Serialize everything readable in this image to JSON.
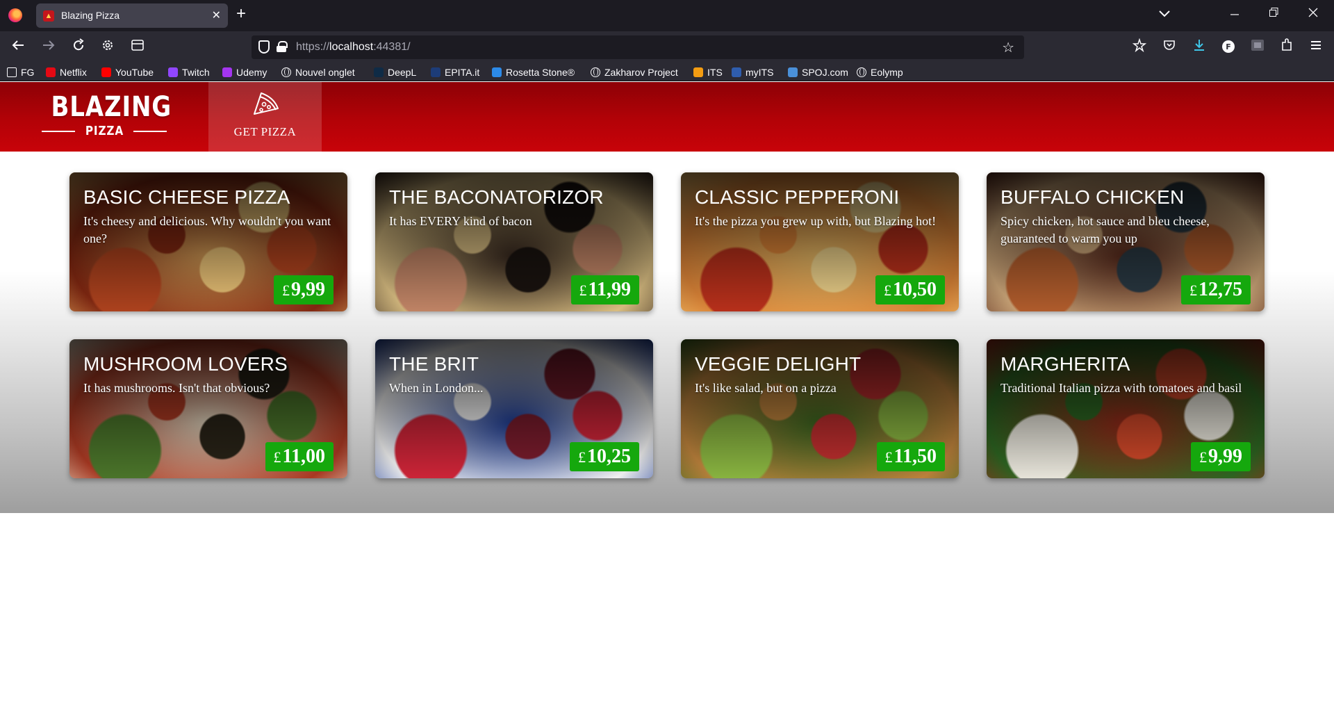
{
  "browser": {
    "tab": {
      "title": "Blazing Pizza",
      "favicon": "pizza-slice-icon"
    },
    "url": {
      "scheme": "https://",
      "host": "localhost",
      "port": ":44381/"
    },
    "bookmarks": [
      {
        "label": "FG",
        "icon": "folder-icon",
        "color": "#fbfbfe"
      },
      {
        "label": "Netflix",
        "icon": "netflix-icon",
        "color": "#e50914"
      },
      {
        "label": "YouTube",
        "icon": "youtube-icon",
        "color": "#ff0000"
      },
      {
        "label": "Twitch",
        "icon": "twitch-icon",
        "color": "#9146ff"
      },
      {
        "label": "Udemy",
        "icon": "udemy-icon",
        "color": "#a435f0"
      },
      {
        "label": "Nouvel onglet",
        "icon": "globe-icon",
        "color": "#fbfbfe"
      },
      {
        "label": "DeepL",
        "icon": "deepl-icon",
        "color": "#0f2b46"
      },
      {
        "label": "EPITA.it",
        "icon": "epita-icon",
        "color": "#1d3c78"
      },
      {
        "label": "Rosetta Stone®",
        "icon": "rosetta-icon",
        "color": "#2c8ae8"
      },
      {
        "label": "Zakharov Project",
        "icon": "globe-icon",
        "color": "#fbfbfe"
      },
      {
        "label": "ITS",
        "icon": "its-icon",
        "color": "#f39c12"
      },
      {
        "label": "myITS",
        "icon": "myits-icon",
        "color": "#2f5dad"
      },
      {
        "label": "SPOJ.com",
        "icon": "spoj-icon",
        "color": "#4a90d9"
      },
      {
        "label": "Eolymp",
        "icon": "globe-icon",
        "color": "#fbfbfe"
      }
    ]
  },
  "header": {
    "logo_main": "BLAZING",
    "logo_sub": "PIZZA",
    "nav_label": "GET PIZZA",
    "nav_icon": "pizza-slice-icon"
  },
  "currency": "£",
  "specials": [
    {
      "title": "Basic Cheese Pizza",
      "description": "It's cheesy and delicious. Why wouldn't you want one?",
      "price": "9,99",
      "palette": [
        "#d9a058",
        "#b5451f",
        "#8a2a12",
        "#f3c97a"
      ]
    },
    {
      "title": "The Baconatorizor",
      "description": "It has EVERY kind of bacon",
      "price": "11,99",
      "palette": [
        "#3a2a20",
        "#c98a6a",
        "#e5c889",
        "#1b1410"
      ]
    },
    {
      "title": "Classic pepperoni",
      "description": "It's the pizza you grew up with, but Blazing hot!",
      "price": "10,50",
      "palette": [
        "#f0c069",
        "#c0321c",
        "#e88b3a",
        "#f6d98f"
      ]
    },
    {
      "title": "Buffalo chicken",
      "description": "Spicy chicken, hot sauce and bleu cheese, guaranteed to warm you up",
      "price": "12,75",
      "palette": [
        "#5a2a1c",
        "#b8602e",
        "#d8b080",
        "#2b3a44"
      ]
    },
    {
      "title": "Mushroom Lovers",
      "description": "It has mushrooms. Isn't that obvious?",
      "price": "11,00",
      "palette": [
        "#e8dcc4",
        "#4e7a2c",
        "#b43c24",
        "#2a2418"
      ]
    },
    {
      "title": "The Brit",
      "description": "When in London...",
      "price": "10,25",
      "palette": [
        "#1f3f9c",
        "#d6263a",
        "#ffffff",
        "#7e1d2e"
      ]
    },
    {
      "title": "Veggie Delight",
      "description": "It's like salad, but on a pizza",
      "price": "11,50",
      "palette": [
        "#3e6b21",
        "#8fbc43",
        "#c7893f",
        "#c63030"
      ]
    },
    {
      "title": "Margherita",
      "description": "Traditional Italian pizza with tomatoes and basil",
      "price": "9,99",
      "palette": [
        "#9b2a1a",
        "#f2efe4",
        "#2f6a23",
        "#d64a2a"
      ]
    }
  ]
}
